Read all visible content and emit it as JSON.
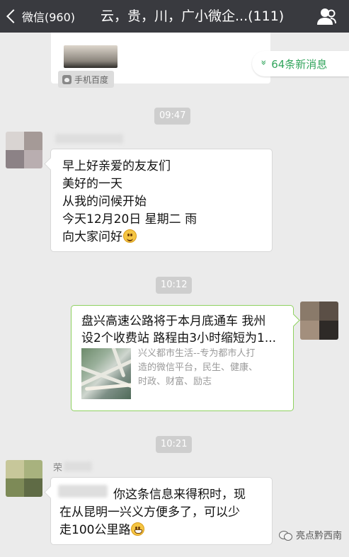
{
  "header": {
    "back_label": "微信(960)",
    "title": "云，贵，川，广小微企...(111)",
    "people_icon": "group-info-icon"
  },
  "top_card": {
    "source_label": "手机百度",
    "source_icon": "baidu-paw-icon"
  },
  "new_messages": {
    "label": "64条新消息",
    "icon": "double-chevron-up-icon",
    "color": "#33a55d"
  },
  "messages": [
    {
      "time": "09:47",
      "lines": [
        "早上好亲爱的友友们",
        "美好的一天",
        "从我的问候开始",
        "今天12月20日 星期二 雨",
        "向大家问好"
      ],
      "trailing_emoji": "smile-emoji"
    },
    {
      "time": "10:12",
      "link_title_lines": [
        "盘兴高速公路将于本月底通车 我州",
        "设2个收费站 路程由3小时缩短为1..."
      ],
      "link_desc_lines": [
        "兴义都市生活--专为都市人打",
        "造的微信平台，民生、健康、",
        "时政、财富、励志"
      ]
    },
    {
      "time": "10:21",
      "sender_name": "荣",
      "lines": [
        "你这条信息来得积时，现",
        "在从昆明一兴义方便多了，可以少",
        "走100公里路"
      ],
      "trailing_emoji": "grin-emoji"
    }
  ],
  "watermark": {
    "text": "亮点黔西南"
  },
  "colors": {
    "header_bg": "#393a3f",
    "chat_bg": "#ebebeb",
    "timestamp_bg": "#cecece",
    "bubble_border_green": "#8ed15f"
  }
}
